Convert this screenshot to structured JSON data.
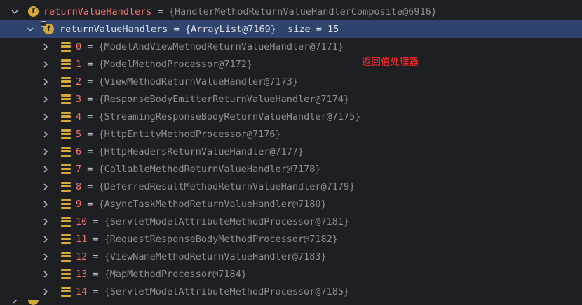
{
  "root": {
    "name": "returnValueHandlers",
    "eq": " = ",
    "value": "{HandlerMethodReturnValueHandlerComposite@6916}",
    "badge": "f"
  },
  "selected": {
    "name": "returnValueHandlers",
    "eq": " = ",
    "value": "{ArrayList@7169}",
    "size": "  size = 15",
    "badge": "f"
  },
  "items": [
    {
      "index": "0",
      "eq": " = ",
      "value": "{ModelAndViewMethodReturnValueHandler@7171}"
    },
    {
      "index": "1",
      "eq": " = ",
      "value": "{ModelMethodProcessor@7172}"
    },
    {
      "index": "2",
      "eq": " = ",
      "value": "{ViewMethodReturnValueHandler@7173}"
    },
    {
      "index": "3",
      "eq": " = ",
      "value": "{ResponseBodyEmitterReturnValueHandler@7174}"
    },
    {
      "index": "4",
      "eq": " = ",
      "value": "{StreamingResponseBodyReturnValueHandler@7175}"
    },
    {
      "index": "5",
      "eq": " = ",
      "value": "{HttpEntityMethodProcessor@7176}"
    },
    {
      "index": "6",
      "eq": " = ",
      "value": "{HttpHeadersReturnValueHandler@7177}"
    },
    {
      "index": "7",
      "eq": " = ",
      "value": "{CallableMethodReturnValueHandler@7178}"
    },
    {
      "index": "8",
      "eq": " = ",
      "value": "{DeferredResultMethodReturnValueHandler@7179}"
    },
    {
      "index": "9",
      "eq": " = ",
      "value": "{AsyncTaskMethodReturnValueHandler@7180}"
    },
    {
      "index": "10",
      "eq": " = ",
      "value": "{ServletModelAttributeMethodProcessor@7181}"
    },
    {
      "index": "11",
      "eq": " = ",
      "value": "{RequestResponseBodyMethodProcessor@7182}"
    },
    {
      "index": "12",
      "eq": " = ",
      "value": "{ViewNameMethodReturnValueHandler@7183}"
    },
    {
      "index": "13",
      "eq": " = ",
      "value": "{MapMethodProcessor@7184}"
    },
    {
      "index": "14",
      "eq": " = ",
      "value": "{ServletModelAttributeMethodProcessor@7185}"
    }
  ],
  "annotation": "返回值处理器",
  "colors": {
    "background": "#1e1f22",
    "selected_row": "#2e436e",
    "field_name": "#f5736e",
    "value_text": "#8c8f94",
    "badge": "#d5a83a",
    "annotation": "#ff2a2a"
  },
  "icons": {
    "field_badge": "field-f-icon",
    "array_element": "array-element-icon",
    "expanded": "chevron-down-icon",
    "collapsed": "chevron-right-icon"
  }
}
